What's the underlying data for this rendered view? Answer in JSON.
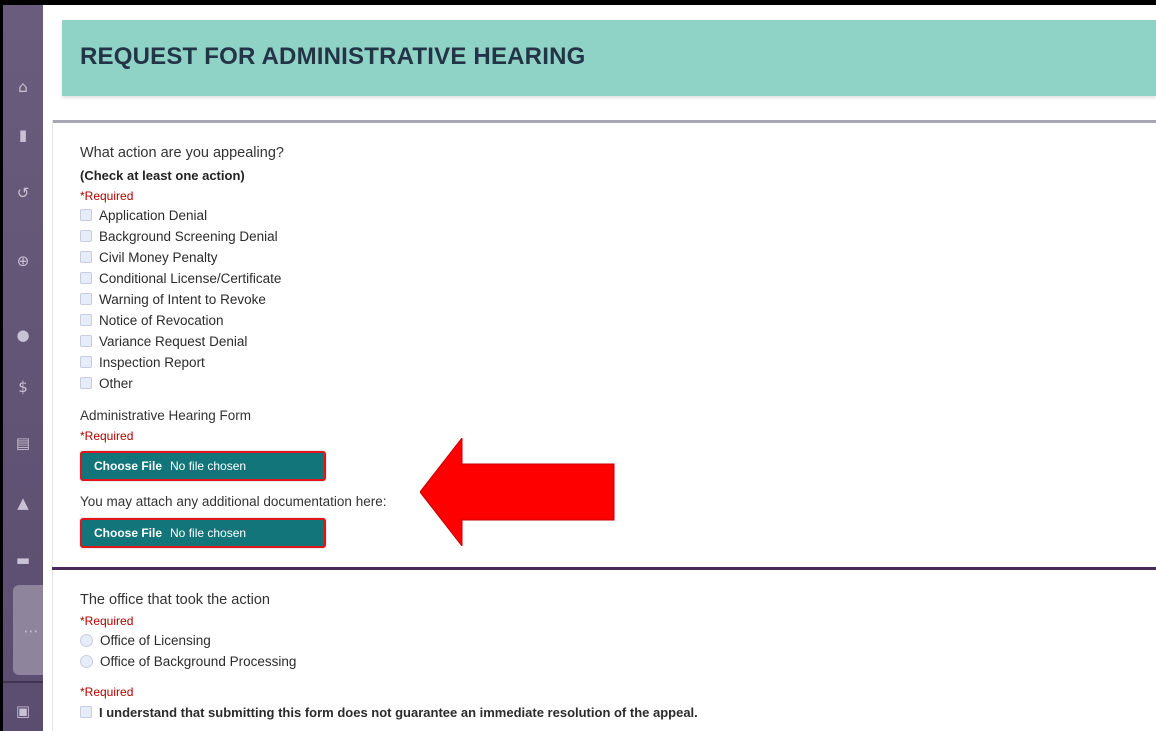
{
  "header": {
    "title": "REQUEST FOR ADMINISTRATIVE HEARING"
  },
  "sidebar": {
    "icons": [
      "home-icon",
      "clipboard-icon",
      "history-icon",
      "add-circle-icon",
      "users-icon",
      "dollar-icon",
      "document-icon",
      "warning-icon",
      "folder-icon",
      "people-icon",
      "form-icon"
    ]
  },
  "section1": {
    "question": "What action are you appealing?",
    "hint": "(Check at least one action)",
    "required": "*Required",
    "options": [
      "Application Denial",
      "Background Screening Denial",
      "Civil Money Penalty",
      "Conditional License/Certificate",
      "Warning of Intent to Revoke",
      "Notice of Revocation",
      "Variance Request Denial",
      "Inspection Report",
      "Other"
    ],
    "form_label": "Administrative Hearing Form",
    "form_required": "*Required",
    "file1": {
      "button": "Choose File",
      "status": "No file chosen"
    },
    "attach_label": "You may attach any additional documentation here:",
    "file2": {
      "button": "Choose File",
      "status": "No file chosen"
    }
  },
  "section2": {
    "question": "The office that took the action",
    "required": "*Required",
    "options": [
      "Office of Licensing",
      "Office of Background Processing"
    ],
    "ack_required": "*Required",
    "ack_label": "I understand that submitting this form does not guarantee an immediate resolution of the appeal."
  },
  "colors": {
    "header_bg": "#8fd3c6",
    "file_button_bg": "#11757a",
    "highlight": "#e0161b",
    "required": "#b00000",
    "sidebar": "#5b4d6f"
  }
}
